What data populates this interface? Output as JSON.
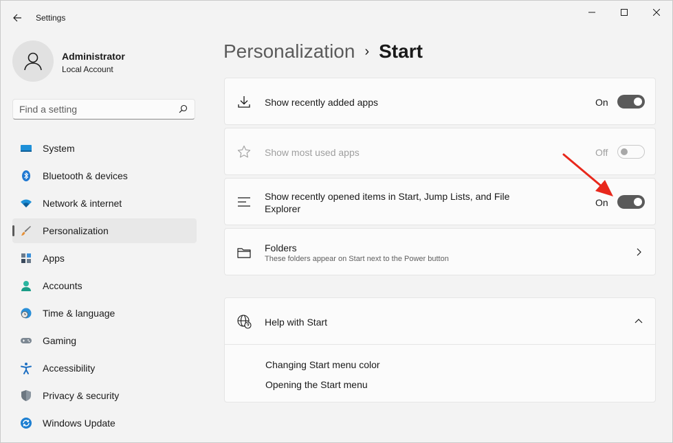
{
  "window": {
    "title": "Settings",
    "icons": {
      "back": "back-arrow-icon",
      "minimize": "minimize-icon",
      "maximize": "maximize-icon",
      "close": "close-icon"
    }
  },
  "user": {
    "name": "Administrator",
    "account_type": "Local Account",
    "icon": "user-avatar-icon"
  },
  "search": {
    "placeholder": "Find a setting",
    "value": "",
    "icon": "search-icon"
  },
  "sidebar": {
    "items": [
      {
        "label": "System",
        "icon": "system-monitor-icon",
        "selected": false
      },
      {
        "label": "Bluetooth & devices",
        "icon": "bluetooth-icon",
        "selected": false
      },
      {
        "label": "Network & internet",
        "icon": "wifi-icon",
        "selected": false
      },
      {
        "label": "Personalization",
        "icon": "paintbrush-icon",
        "selected": true
      },
      {
        "label": "Apps",
        "icon": "apps-icon",
        "selected": false
      },
      {
        "label": "Accounts",
        "icon": "accounts-icon",
        "selected": false
      },
      {
        "label": "Time & language",
        "icon": "clock-globe-icon",
        "selected": false
      },
      {
        "label": "Gaming",
        "icon": "gamepad-icon",
        "selected": false
      },
      {
        "label": "Accessibility",
        "icon": "accessibility-icon",
        "selected": false
      },
      {
        "label": "Privacy & security",
        "icon": "shield-icon",
        "selected": false
      },
      {
        "label": "Windows Update",
        "icon": "windows-update-icon",
        "selected": false
      }
    ]
  },
  "breadcrumb": {
    "parent": "Personalization",
    "separator": "›",
    "current": "Start"
  },
  "settings": [
    {
      "title": "Show recently added apps",
      "state": "On",
      "enabled": true,
      "icon": "download-icon"
    },
    {
      "title": "Show most used apps",
      "state": "Off",
      "enabled": false,
      "icon": "star-icon"
    },
    {
      "title": "Show recently opened items in Start, Jump Lists, and File Explorer",
      "state": "On",
      "enabled": true,
      "icon": "list-lines-icon"
    }
  ],
  "folders": {
    "title": "Folders",
    "subtitle": "These folders appear on Start next to the Power button",
    "icon": "folder-icon",
    "chevron": "chevron-right-icon"
  },
  "help": {
    "title": "Help with Start",
    "icon": "globe-help-icon",
    "chevron": "chevron-up-icon",
    "links": [
      "Changing Start menu color",
      "Opening the Start menu"
    ]
  },
  "colors": {
    "accent_toggle": "#5a5a5a",
    "annotation_arrow": "#e8281c",
    "background": "#f3f3f3",
    "card": "#fbfbfb"
  }
}
